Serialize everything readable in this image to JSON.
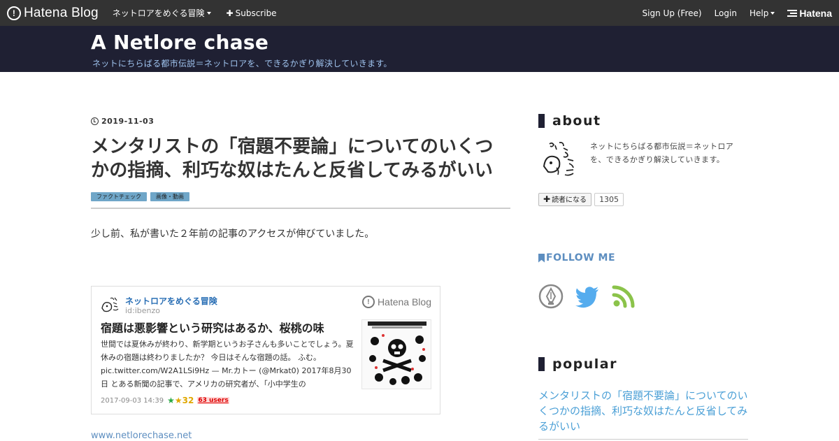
{
  "global_bar": {
    "logo_text": "Hatena Blog",
    "blog_menu": "ネットロアをめぐる冒険",
    "subscribe": "Subscribe",
    "signup": "Sign Up (Free)",
    "login": "Login",
    "help": "Help",
    "hatena": "Hatena"
  },
  "blog": {
    "title": "A Netlore chase",
    "description": "ネットにちらばる都市伝説＝ネットロアを、できるかぎり解決していきます。"
  },
  "entry": {
    "date": "2019-11-03",
    "title": "メンタリストの「宿題不要論」についてのいくつかの指摘、利巧な奴はたんと反省してみるがいい",
    "categories": [
      "ファクトチェック",
      "画像・動画"
    ],
    "lead": "少し前、私が書いた２年前の記事のアクセスが伸びていました。"
  },
  "embed_card": {
    "blog_name": "ネットロアをめぐる冒険",
    "author_id": "id:ibenzo",
    "brand": "Hatena Blog",
    "title": "宿題は悪影響という研究はあるか、桜桃の味",
    "excerpt": "世間では夏休みが終わり、新学期というお子さんも多いことでしょう。夏休みの宿題は終わりましたか？ 今日はそんな宿題の話。 ふむ。 pic.twitter.com/W2A1LSi9Hz — Mr.カトー (@Mrkat0) 2017年8月30日 とある新聞の記事で、アメリカの研究者が、「小中学生の",
    "timestamp": "2017-09-03 14:39",
    "star_count": "32",
    "users": "63 users"
  },
  "source_link": "www.netlorechase.net",
  "sidebar": {
    "about_heading": "about",
    "about_text": "ネットにちらばる都市伝説＝ネットロアを、できるかぎり解決していきます。",
    "subscribe_label": "読者になる",
    "subscriber_count": "1305",
    "follow_heading": "FOLLOW ME",
    "popular_heading": "popular",
    "popular_entry": "メンタリストの「宿題不要論」についてのいくつかの指摘、利巧な奴はたんと反省してみるがいい"
  },
  "colors": {
    "global_bar": "#333333",
    "header_bg": "#1f2033",
    "header_desc": "#9fc3ee",
    "category_tag": "#6fa6c8",
    "link": "#4a9fd6",
    "twitter": "#55acee",
    "rss": "#8bc34a"
  }
}
